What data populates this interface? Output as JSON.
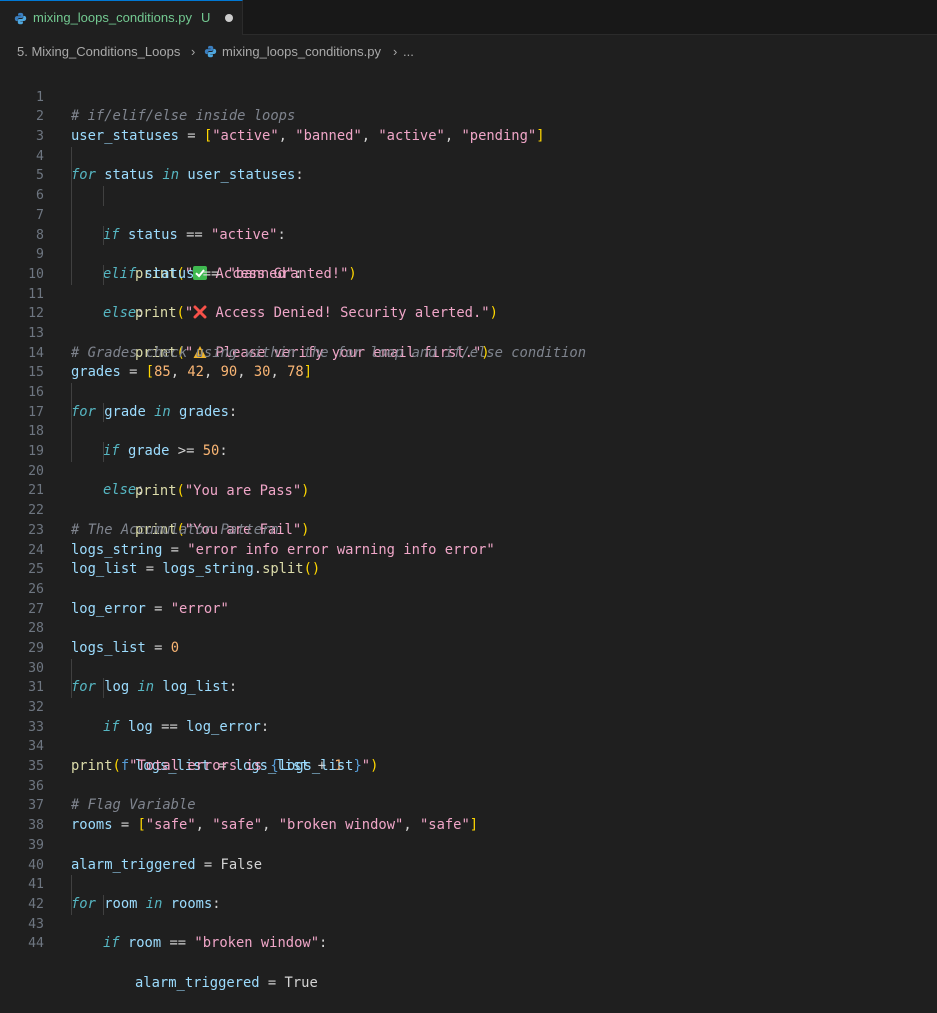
{
  "tab": {
    "filename": "mixing_loops_conditions.py",
    "status": "U",
    "file_icon": "python-icon",
    "dirty_icon": "unsaved-dot-icon"
  },
  "breadcrumb": {
    "folder": "5. Mixing_Conditions_Loops",
    "file": "mixing_loops_conditions.py",
    "symbol": "...",
    "separator": "›"
  },
  "colors": {
    "keyword": "#56b6c2",
    "string": "#f0a6c8",
    "number": "#f9b574",
    "variable": "#9cdcfe",
    "function": "#dcdcaa",
    "comment": "#7f848e",
    "bracket": "#ffd700"
  },
  "lines": [
    {
      "n": "1"
    },
    {
      "n": "2"
    },
    {
      "n": "3"
    },
    {
      "n": "4"
    },
    {
      "n": "5"
    },
    {
      "n": "6"
    },
    {
      "n": "7"
    },
    {
      "n": "8"
    },
    {
      "n": "9"
    },
    {
      "n": "10"
    },
    {
      "n": "11"
    },
    {
      "n": "12"
    },
    {
      "n": "13"
    },
    {
      "n": "14"
    },
    {
      "n": "15"
    },
    {
      "n": "16"
    },
    {
      "n": "17"
    },
    {
      "n": "18"
    },
    {
      "n": "19"
    },
    {
      "n": "20"
    },
    {
      "n": "21"
    },
    {
      "n": "22"
    },
    {
      "n": "23"
    },
    {
      "n": "24"
    },
    {
      "n": "25"
    },
    {
      "n": "26"
    },
    {
      "n": "27"
    },
    {
      "n": "28"
    },
    {
      "n": "29"
    },
    {
      "n": "30"
    },
    {
      "n": "31"
    },
    {
      "n": "32"
    },
    {
      "n": "33"
    },
    {
      "n": "34"
    },
    {
      "n": "35"
    },
    {
      "n": "36"
    },
    {
      "n": "37"
    },
    {
      "n": "38"
    },
    {
      "n": "39"
    },
    {
      "n": "40"
    },
    {
      "n": "41"
    },
    {
      "n": "42"
    },
    {
      "n": "43"
    },
    {
      "n": "44"
    }
  ],
  "code": {
    "l1": "# if/elif/else inside loops",
    "l2": {
      "a": "user_statuses",
      "b": " = ",
      "c": "[",
      "s1": "\"active\"",
      "s2": "\"banned\"",
      "s3": "\"active\"",
      "s4": "\"pending\"",
      "d": "]",
      "sep": ", "
    },
    "l4": {
      "kw1": "for",
      "v1": "status",
      "kw2": "in",
      "v2": "user_statuses",
      "colon": ":"
    },
    "l6": {
      "kw": "if",
      "v": "status",
      "op": " == ",
      "s": "\"active\"",
      "colon": ":"
    },
    "l7": {
      "fn": "print",
      "q1": "\"",
      "emoji": "check-mark-icon",
      "txt": " Access Granted!\"",
      "p1": "(",
      "p2": ")"
    },
    "l8": {
      "kw": "elif",
      "v": "status",
      "op": " == ",
      "s": "\"banned\"",
      "colon": ":"
    },
    "l9": {
      "fn": "print",
      "q1": "\"",
      "emoji": "cross-mark-icon",
      "txt": " Access Denied! Security alerted.\"",
      "p1": "(",
      "p2": ")"
    },
    "l10": {
      "kw": "else",
      "colon": ":"
    },
    "l11": {
      "fn": "print",
      "q1": "\"",
      "emoji": "warning-icon",
      "txt": " Please verify your email first.\"",
      "p1": "(",
      "p2": ")"
    },
    "l13": "# Grades check using within the for loop and if/else condition",
    "l14": {
      "v": "grades",
      "op": " = ",
      "b1": "[",
      "nums": [
        "85",
        "42",
        "90",
        "30",
        "78"
      ],
      "b2": "]",
      "sep": ", "
    },
    "l16": {
      "kw1": "for",
      "v1": "grade",
      "kw2": "in",
      "v2": "grades",
      "colon": ":"
    },
    "l17": {
      "kw": "if",
      "v": "grade",
      "op": " >= ",
      "num": "50",
      "colon": ":"
    },
    "l18": {
      "fn": "print",
      "s": "\"You are Pass\"",
      "p1": "(",
      "p2": ")"
    },
    "l19": {
      "kw": "else",
      "colon": ":"
    },
    "l20": {
      "fn": "print",
      "s": "\"You are Fail\"",
      "p1": "(",
      "p2": ")"
    },
    "l22": "# The Accumulator Pattern",
    "l23": {
      "v": "logs_string",
      "op": " = ",
      "s": "\"error info error warning info error\""
    },
    "l24": {
      "v": "log_list",
      "op": " = ",
      "v2": "logs_string",
      "dot": ".",
      "fn": "split",
      "p": "()"
    },
    "l26": {
      "v": "log_error",
      "op": " = ",
      "s": "\"error\""
    },
    "l28": {
      "v": "logs_list",
      "op": " = ",
      "num": "0"
    },
    "l30": {
      "kw1": "for",
      "v1": "log",
      "kw2": "in",
      "v2": "log_list",
      "colon": ":"
    },
    "l31": {
      "kw": "if",
      "v": "log",
      "op": " == ",
      "v2": "log_error",
      "colon": ":"
    },
    "l32": {
      "v": "logs_list",
      "op": " = ",
      "v2": "logs_list",
      "op2": " + ",
      "num": "1"
    },
    "l34": {
      "fn": "print",
      "p1": "(",
      "f": "f",
      "s1": "\"Total errors is ",
      "b1": "{",
      "v": "logs_list",
      "b2": "}",
      "s2": "\"",
      "p2": ")"
    },
    "l36": "# Flag Variable",
    "l37": {
      "v": "rooms",
      "op": " = ",
      "b1": "[",
      "items": [
        "\"safe\"",
        "\"safe\"",
        "\"broken window\"",
        "\"safe\""
      ],
      "b2": "]",
      "sep": ", "
    },
    "l39": {
      "v": "alarm_triggered",
      "op": " = ",
      "c": "False"
    },
    "l41": {
      "kw1": "for",
      "v1": "room",
      "kw2": "in",
      "v2": "rooms",
      "colon": ":"
    },
    "l42": {
      "kw": "if",
      "v": "room",
      "op": " == ",
      "s": "\"broken window\"",
      "colon": ":"
    },
    "l43": {
      "v": "alarm_triggered",
      "op": " = ",
      "c": "True"
    }
  }
}
